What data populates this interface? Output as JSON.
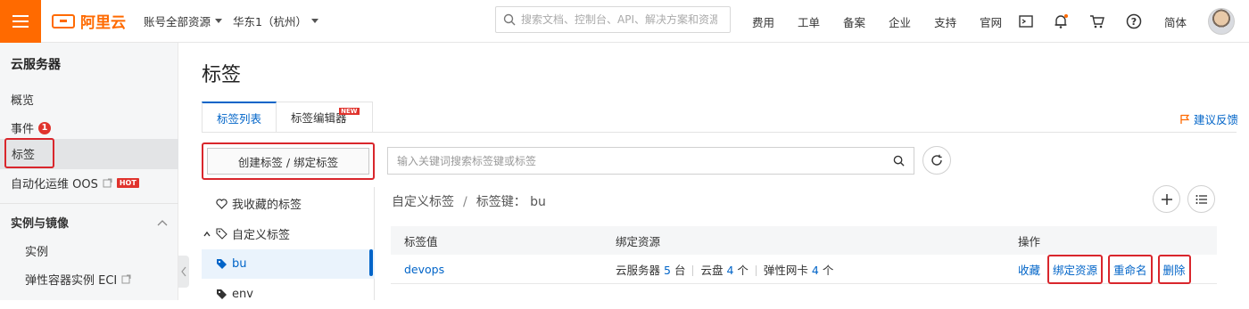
{
  "topbar": {
    "logo_text": "阿里云",
    "account_select": "账号全部资源",
    "region_select": "华东1（杭州）",
    "search_placeholder": "搜索文档、控制台、API、解决方案和资源",
    "nav": [
      "费用",
      "工单",
      "备案",
      "企业",
      "支持",
      "官网"
    ],
    "language": "简体",
    "icons": [
      "terminal-icon",
      "bell-icon",
      "cart-icon",
      "help-icon"
    ]
  },
  "sidebar": {
    "title": "云服务器",
    "items": [
      {
        "label": "概览"
      },
      {
        "label": "事件",
        "badge": "1"
      },
      {
        "label": "标签",
        "active": true
      },
      {
        "label": "自动化运维 OOS",
        "tag": "HOT"
      }
    ],
    "section": "实例与镜像",
    "sub_items": [
      {
        "label": "实例"
      },
      {
        "label": "弹性容器实例 ECI"
      }
    ]
  },
  "main": {
    "title": "标签",
    "tabs": [
      {
        "label": "标签列表",
        "active": true
      },
      {
        "label": "标签编辑器",
        "new_tag": "NEW"
      }
    ],
    "feedback": "建议反馈",
    "create_button": "创建标签 / 绑定标签",
    "tree": [
      {
        "label": "我收藏的标签",
        "icon": "heart-icon"
      },
      {
        "label": "自定义标签",
        "icon": "tag-outline-icon"
      },
      {
        "label": "bu",
        "icon": "tag-icon",
        "selected": true
      },
      {
        "label": "env",
        "icon": "tag-icon"
      }
    ],
    "keyword_search_placeholder": "输入关键词搜索标签键或标签",
    "breadcrumb": {
      "root": "自定义标签",
      "sep": "/",
      "key_label": "标签键：",
      "key": "bu"
    },
    "table": {
      "headers": [
        "标签值",
        "绑定资源",
        "操作"
      ],
      "rows": [
        {
          "value": "devops",
          "resources": [
            {
              "name": "云服务器",
              "count": "5",
              "unit": "台"
            },
            {
              "name": "云盘",
              "count": "4",
              "unit": "个"
            },
            {
              "name": "弹性网卡",
              "count": "4",
              "unit": "个"
            }
          ],
          "actions": [
            "收藏",
            "绑定资源",
            "重命名",
            "删除"
          ]
        }
      ]
    }
  },
  "colors": {
    "brand": "#ff6a00",
    "link": "#0064c8",
    "highlight": "#d9262c"
  }
}
